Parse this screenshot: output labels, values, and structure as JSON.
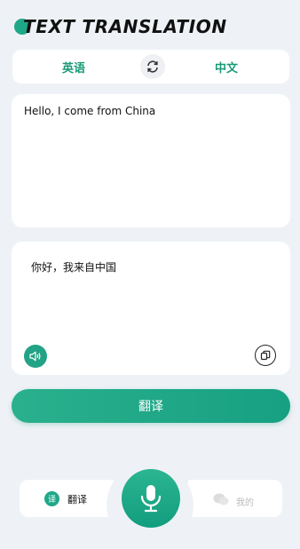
{
  "header": {
    "title": "TEXT TRANSLATION"
  },
  "languages": {
    "source": "英语",
    "target": "中文"
  },
  "input": {
    "text": "Hello, I come from China"
  },
  "output": {
    "text": "你好，我来自中国"
  },
  "actions": {
    "translate_label": "翻译"
  },
  "bottom_nav": {
    "left_badge": "译",
    "left_label": "翻译",
    "right_label": "我的"
  },
  "colors": {
    "accent": "#1fa888",
    "background": "#eef2f6"
  }
}
